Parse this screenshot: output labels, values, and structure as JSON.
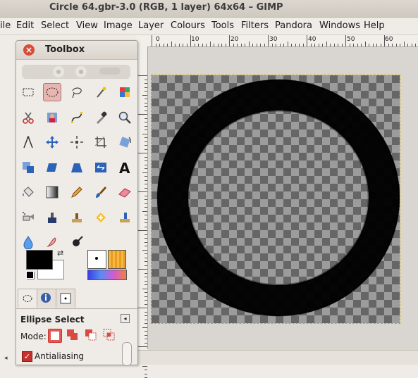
{
  "window": {
    "title": "Circle 64.gbr-3.0 (RGB, 1 layer) 64x64 – GIMP"
  },
  "menubar": {
    "items": [
      "ile",
      "Edit",
      "Select",
      "View",
      "Image",
      "Layer",
      "Colours",
      "Tools",
      "Filters",
      "Pandora",
      "Windows",
      "Help"
    ]
  },
  "ruler": {
    "labels": [
      "0",
      "10",
      "20",
      "30",
      "40",
      "50",
      "60"
    ]
  },
  "toolbox": {
    "title": "Toolbox",
    "tools": [
      "rect-select-icon",
      "ellipse-select-icon",
      "lasso-icon",
      "fuzzy-select-icon",
      "select-by-color-icon",
      "scissors-icon",
      "foreground-select-icon",
      "paths-icon",
      "color-picker-icon",
      "zoom-icon",
      "measure-icon",
      "move-icon",
      "align-icon",
      "crop-icon",
      "rotate-icon",
      "scale-icon",
      "shear-icon",
      "perspective-icon",
      "flip-icon",
      "text-icon",
      "bucket-fill-icon",
      "blend-icon",
      "pencil-icon",
      "paintbrush-icon",
      "eraser-icon",
      "airbrush-icon",
      "ink-icon",
      "clone-icon",
      "heal-icon",
      "perspective-clone-icon",
      "blur-icon",
      "smudge-icon",
      "dodge-burn-icon"
    ],
    "active_tool": "ellipse-select-icon",
    "colors": {
      "foreground": "#000000",
      "background": "#ffffff"
    }
  },
  "tool_options": {
    "title": "Ellipse Select",
    "mode_label": "Mode:",
    "antialiasing_label": "Antialiasing",
    "antialiasing_checked": true
  },
  "image": {
    "ring_color": "#000000"
  }
}
